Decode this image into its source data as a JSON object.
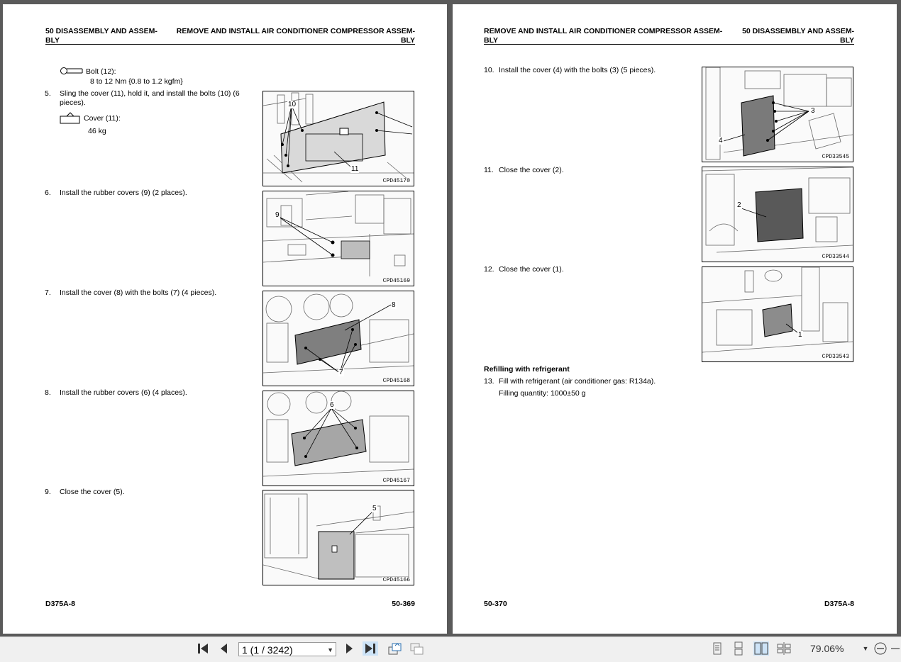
{
  "left_page": {
    "header_left": [
      "50 DISASSEMBLY AND ASSEM-",
      "BLY"
    ],
    "header_right": [
      "REMOVE AND INSTALL AIR CONDITIONER COMPRESSOR ASSEM-",
      "BLY"
    ],
    "torque": {
      "label": "Bolt (12):",
      "value": "8 to 12 Nm {0.8 to 1.2 kgfm}"
    },
    "step5": {
      "num": "5.",
      "text": [
        "Sling the cover (11), hold it, and install the bolts (10) (6",
        "pieces)."
      ],
      "weight_label": "Cover (11):",
      "weight_value": "46 kg"
    },
    "step6": {
      "num": "6.",
      "text": "Install the rubber covers (9) (2 places)."
    },
    "step7": {
      "num": "7.",
      "text": "Install the cover (8) with the bolts (7) (4 pieces)."
    },
    "step8": {
      "num": "8.",
      "text": "Install the rubber covers (6) (4 places)."
    },
    "step9": {
      "num": "9.",
      "text": "Close the cover (5)."
    },
    "figures": [
      {
        "code": "CPD45170",
        "callouts": [
          "10",
          "11"
        ]
      },
      {
        "code": "CPD45169",
        "callouts": [
          "9"
        ]
      },
      {
        "code": "CPD45168",
        "callouts": [
          "8",
          "7"
        ]
      },
      {
        "code": "CPD45167",
        "callouts": [
          "6"
        ]
      },
      {
        "code": "CPD45166",
        "callouts": [
          "5"
        ]
      }
    ],
    "footer_left": "D375A-8",
    "footer_right": "50-369"
  },
  "right_page": {
    "header_left": [
      "REMOVE AND INSTALL AIR CONDITIONER COMPRESSOR ASSEM-",
      "BLY"
    ],
    "header_right": [
      "50 DISASSEMBLY AND ASSEM-",
      "BLY"
    ],
    "step10": {
      "num": "10.",
      "text": "Install the cover (4) with the bolts (3) (5 pieces)."
    },
    "step11": {
      "num": "11.",
      "text": "Close the cover (2)."
    },
    "step12": {
      "num": "12.",
      "text": "Close the cover (1)."
    },
    "section_title": "Refilling with refrigerant",
    "step13": {
      "num": "13.",
      "text": "Fill with refrigerant (air conditioner gas: R134a).",
      "quantity": "Filling quantity: 1000±50 g"
    },
    "figures": [
      {
        "code": "CPD33545",
        "callouts": [
          "3",
          "4"
        ]
      },
      {
        "code": "CPD33544",
        "callouts": [
          "2"
        ]
      },
      {
        "code": "CPD33543",
        "callouts": [
          "1"
        ]
      }
    ],
    "footer_left": "50-370",
    "footer_right": "D375A-8"
  },
  "toolbar": {
    "page_select_value": "1 (1 / 3242)",
    "zoom_value": "79.06%",
    "icons": [
      "first-page-icon",
      "previous-page-icon",
      "next-page-icon",
      "last-page-icon",
      "go-back-icon",
      "go-forward-icon",
      "single-page-view-icon",
      "continuous-view-icon",
      "two-page-view-icon",
      "two-page-continuous-view-icon",
      "zoom-dropdown-icon",
      "zoom-out-icon"
    ]
  },
  "colors": {
    "viewer_background": "#5a5a5a",
    "toolbar_background": "#f0f0f0",
    "page_background": "#ffffff",
    "active_view_button": "#cde3f7"
  }
}
